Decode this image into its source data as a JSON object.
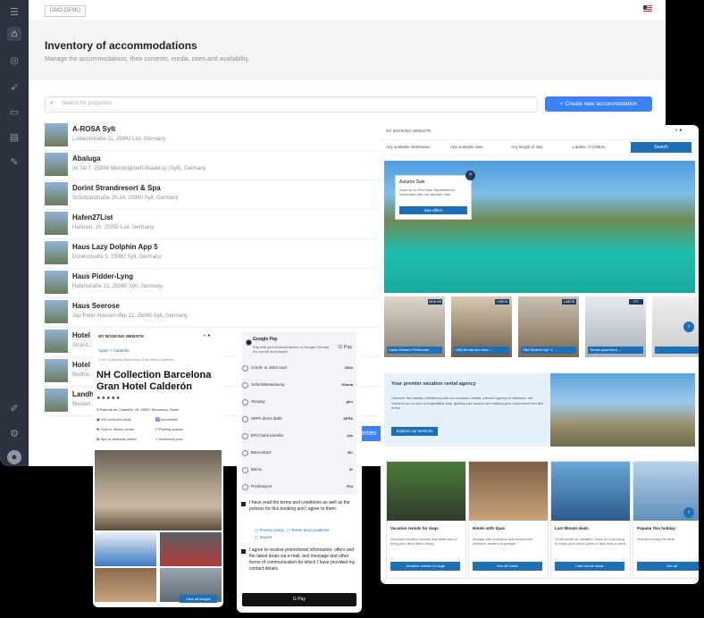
{
  "admin": {
    "env_badge": "DMO-DEMO",
    "title": "Inventory of accommodations",
    "subtitle": "Manage the accommodations, their contents, media, rates and availability.",
    "search_placeholder": "Search for properties",
    "create_button": "+ Create new accommodation",
    "more_button": "perties",
    "sidebar_icons": [
      "menu-icon",
      "home-icon",
      "globe-icon",
      "rocket-icon",
      "monitor-icon",
      "folder-icon",
      "pin-icon",
      "edit-icon",
      "settings-icon",
      "avatar-icon"
    ],
    "properties": [
      {
        "name": "A-ROSA Sylt",
        "address": "Listlandstraße 11, 25992 List, Germany"
      },
      {
        "name": "Abaluga",
        "address": "Im Tal 7, 25996 Wenningstedt-Braderup (Sylt), Germany"
      },
      {
        "name": "Dorint Strandresort & Spa",
        "address": "Schützenstraße 20-24, 25980 Sylt, Germany"
      },
      {
        "name": "Hafen27List",
        "address": "Hafenstr. 20, 25992 List, Germany"
      },
      {
        "name": "Haus Lazy Dolphin App 5",
        "address": "Dünenstraße 5, 25980 Sylt, Germany"
      },
      {
        "name": "Haus Pidder-Lyng",
        "address": "Hafenstraße 13, 25980 Sylt, Germany"
      },
      {
        "name": "Haus Seerose",
        "address": "Jap-Peter-Hansen-Wai 12, 25980 Sylt, Germany"
      },
      {
        "name": "Hotel",
        "address": "Strand..."
      },
      {
        "name": "Hotel",
        "address": "Berthin..."
      },
      {
        "name": "Landh",
        "address": "Westerl..."
      }
    ]
  },
  "website": {
    "brand": "MY BOOKING WEBSITE",
    "search_fields": [
      "Any available destination",
      "Any available date",
      "Any length of stay",
      "1 adults, 0 children"
    ],
    "search_button": "Search",
    "promo": {
      "title": "Autumn Sale",
      "text": "Save up to 20% from September to November with our Autumn Sale",
      "button": "See offers"
    },
    "cards": [
      {
        "tag": "NEW 5/8",
        "label": "Calas Modern Penthouse ..."
      },
      {
        "tag": "2 BEDS",
        "label": "Villa Bonita sea view ..."
      },
      {
        "tag": "4 BEDS",
        "label": "Villa Modern Apt. 4 ..."
      },
      {
        "tag": "FIT",
        "label": "Tennis apartment ..."
      },
      {
        "tag": "",
        "label": "..."
      }
    ],
    "agency": {
      "title": "Your premier vacation rental agency",
      "text": "Discover the beauty of Mallorca with our vacation rentals: premier agency in Mallorca. We connect you to your unforgettable stay, guiding you around and making your experience feel like a first.",
      "button": "Explore our services"
    },
    "dest_cards": [
      {
        "title": "Vacation rentals for dogs",
        "text": "Discover vacation rentals that allow you to bring your best friend along",
        "button": "Vacation rentals for dogs"
      },
      {
        "title": "Hotels with Spas",
        "text": "Indulge with luxurious spa resorts and wellness centers to pamper",
        "button": "See all hotels"
      },
      {
        "title": "Last Minute deals",
        "text": "Great deals for vacation! Save on a booking to enjoy your travel plans in less than a week",
        "button": "Last minute deals"
      },
      {
        "title": "Popular this holiday",
        "text": "Find and enjoy the best",
        "button": "See all"
      }
    ]
  },
  "booking": {
    "brand": "MY BOOKING WEBSITE",
    "crumbs": "Spain  >  Cataluña",
    "back": "< NH Collection Barcelona Gran Hotel Calderón",
    "hotel_name": "NH Collection Barcelona Gran Hotel Calderón",
    "stars": "★★★★★",
    "address": "Rambla de Cataluña, 26, 08007 Barcelona, Spain",
    "amenities": [
      "24h reception desk",
      "Accessible",
      "Gym or fitness center",
      "Parking spaces",
      "Spa or wellness center",
      "Swimming pool"
    ],
    "more_images": "View all images"
  },
  "payment": {
    "google_pay_title": "Google Pay",
    "google_pay_text": "Pay with your Android device or Google Chrome. It's secure and simple.",
    "google_pay_logo": "G Pay",
    "methods": [
      {
        "label": "Credit- or debit card",
        "logo": "VISA"
      },
      {
        "label": "Sofortüberweisung",
        "logo": "Klarna"
      },
      {
        "label": "Giropay",
        "logo": "giro"
      },
      {
        "label": "SEPA direct debit",
        "logo": "SEPA"
      },
      {
        "label": "EPS bank transfer",
        "logo": "eps"
      },
      {
        "label": "Bancontact",
        "logo": "BC"
      },
      {
        "label": "iDEAL",
        "logo": "iD"
      },
      {
        "label": "Przelewy24",
        "logo": "P24"
      }
    ],
    "terms": "I have read the terms and conditions as well as the policies for this booking and I agree to them.",
    "link_privacy": "Privacy policy",
    "link_terms": "Terms and conditions",
    "link_imprint": "Imprint",
    "marketing": "I agree to receive promotional information, offers and the latest deals via e-mail, text message and other forms of communication for which I have provided my contact details",
    "pay_button": "G Pay"
  }
}
